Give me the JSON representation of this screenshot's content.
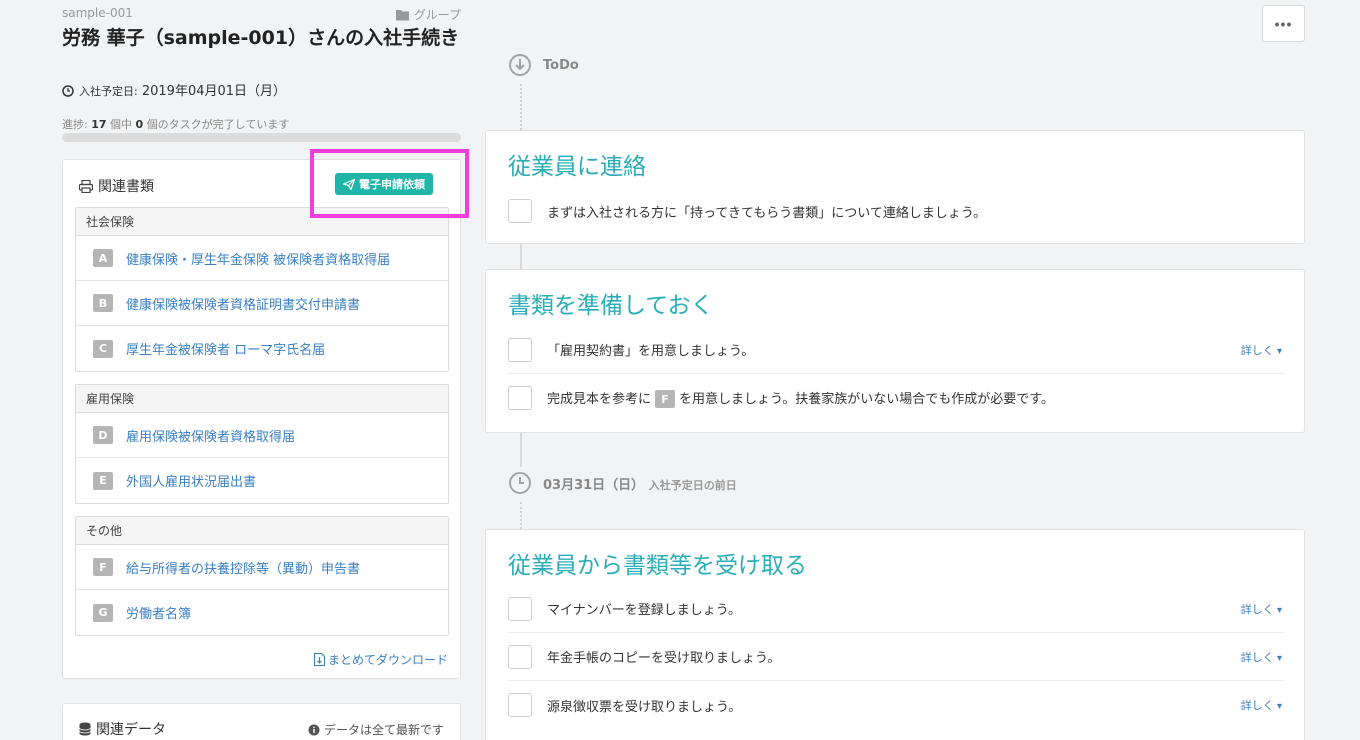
{
  "breadcrumb": {
    "id": "sample-001",
    "group": "グループ"
  },
  "page": {
    "title": "労務 華子（sample-001）さんの入社手続き",
    "join_date_label": "入社予定日:",
    "join_date_value": "2019年04月01日（月）"
  },
  "progress": {
    "prefix": "進捗:",
    "total": "17",
    "mid": "個中",
    "done": "0",
    "suffix": "個のタスクが完了しています",
    "fraction": 0
  },
  "docs": {
    "heading": "関連書類",
    "apply_button": "電子申請依頼",
    "groups": [
      {
        "title": "社会保険",
        "items": [
          {
            "badge": "A",
            "label": "健康保険・厚生年金保険 被保険者資格取得届"
          },
          {
            "badge": "B",
            "label": "健康保険被保険者資格証明書交付申請書"
          },
          {
            "badge": "C",
            "label": "厚生年金被保険者 ローマ字氏名届"
          }
        ]
      },
      {
        "title": "雇用保険",
        "items": [
          {
            "badge": "D",
            "label": "雇用保険被保険者資格取得届"
          },
          {
            "badge": "E",
            "label": "外国人雇用状況届出書"
          }
        ]
      },
      {
        "title": "その他",
        "items": [
          {
            "badge": "F",
            "label": "給与所得者の扶養控除等（異動）申告書"
          },
          {
            "badge": "G",
            "label": "労働者名簿"
          }
        ]
      }
    ],
    "download_link": "まとめてダウンロード"
  },
  "related_data": {
    "heading": "関連データ",
    "note": "データは全て最新です"
  },
  "menu_button": "•••",
  "timeline": {
    "todo_label": "ToDo",
    "date_label": "03月31日（日）",
    "date_sub": "入社予定日の前日"
  },
  "tasks": [
    {
      "title": "従業員に連絡",
      "rows": [
        {
          "text": "まずは入社される方に「持ってきてもらう書類」について連絡しましょう。",
          "more": ""
        }
      ]
    },
    {
      "title": "書類を準備しておく",
      "rows": [
        {
          "text": "「雇用契約書」を用意しましょう。",
          "more": "詳しく"
        },
        {
          "text_pre": "完成見本を参考に",
          "badge": "F",
          "text_post": "を用意しましょう。扶養家族がいない場合でも作成が必要です。",
          "more": ""
        }
      ]
    },
    {
      "title": "従業員から書類等を受け取る",
      "rows": [
        {
          "text": "マイナンバーを登録しましょう。",
          "more": "詳しく"
        },
        {
          "text": "年金手帳のコピーを受け取りましょう。",
          "more": "詳しく"
        },
        {
          "text": "源泉徴収票を受け取りましょう。",
          "more": "詳しく"
        }
      ]
    }
  ],
  "colors": {
    "accent": "#29aeb8",
    "button": "#1fb5a8",
    "link": "#3a7fc4",
    "highlight": "#f23ee0"
  }
}
